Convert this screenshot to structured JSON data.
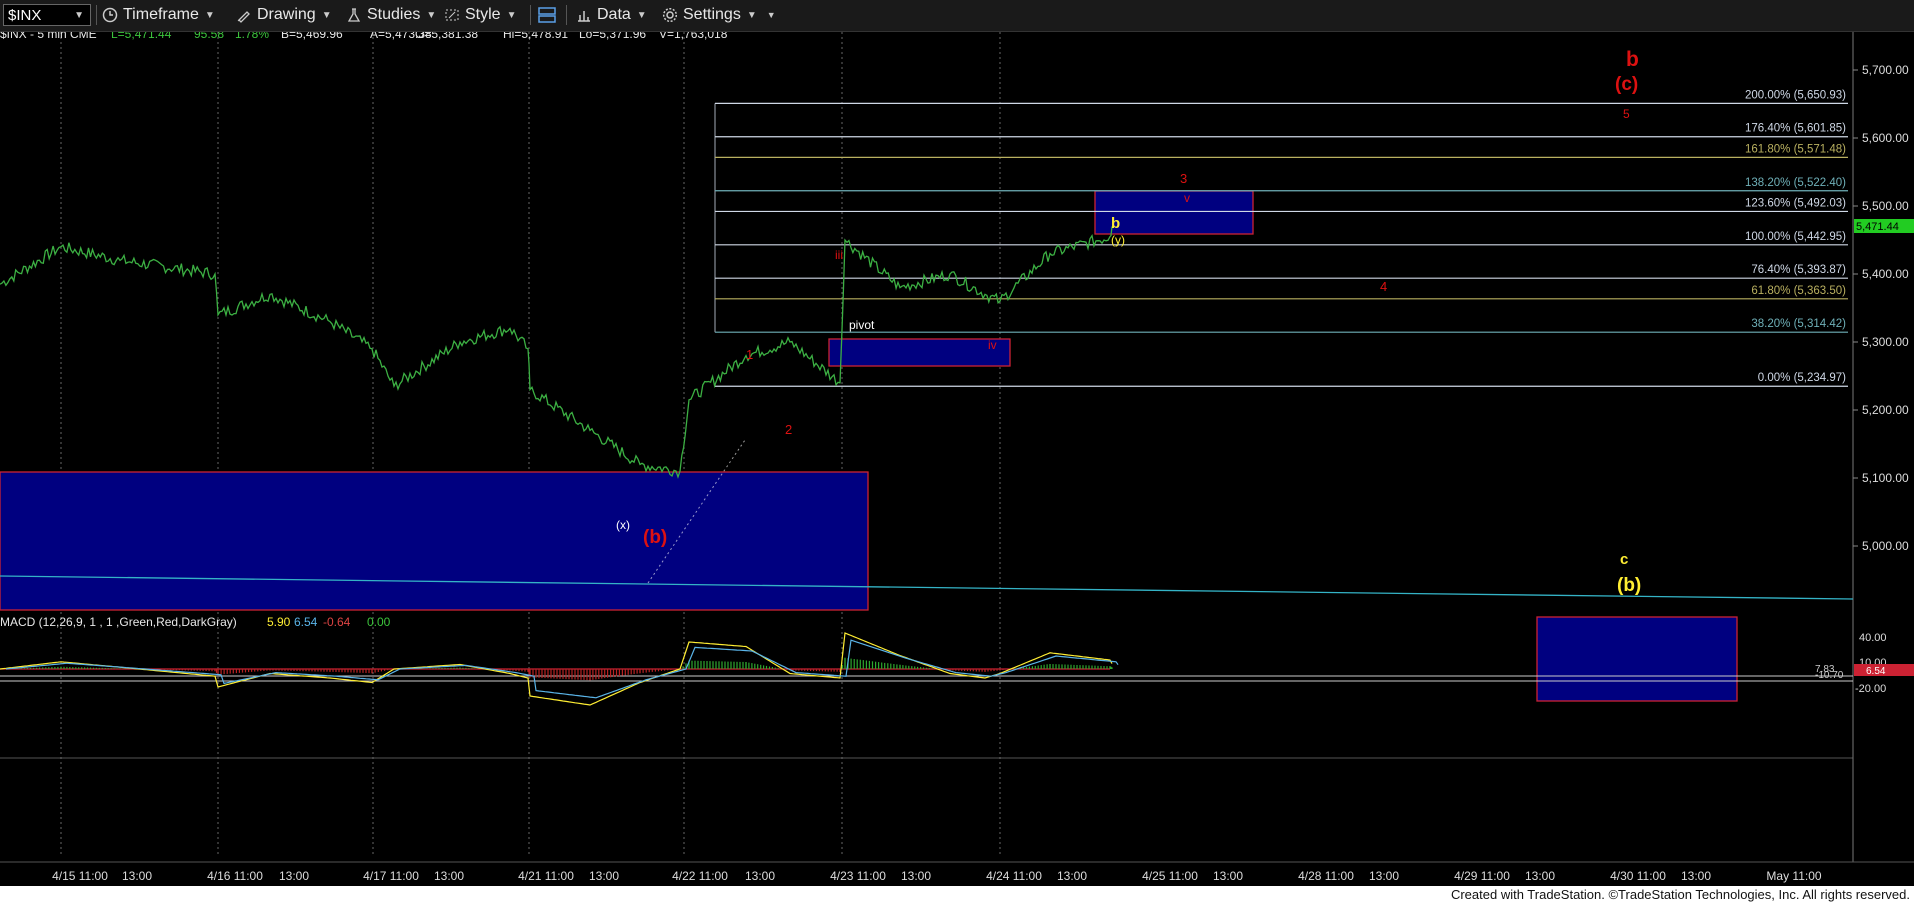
{
  "toolbar": {
    "symbol": "$INX",
    "timeframe": "Timeframe",
    "drawing": "Drawing",
    "studies": "Studies",
    "style": "Style",
    "data": "Data",
    "settings": "Settings"
  },
  "header": {
    "name": "$INX - 5 min CME",
    "last": "L=5,471.44",
    "change": "95.58",
    "pct": "1.78%",
    "bid": "B=5,469.96",
    "ask": "A=5,473.38",
    "open": "O=5,381.38",
    "high": "Hi=5,478.91",
    "low": "Lo=5,371.96",
    "volume": "V=1,763,018"
  },
  "macd": {
    "label": "MACD (12,26,9, 1 , 1 ,Green,Red,DarkGray)",
    "v1": "5.90",
    "v2": "6.54",
    "v3": "-0.64",
    "v4": "0.00",
    "axis": [
      "40.00",
      "10.00",
      "-20.00"
    ],
    "tag_a": "7.83",
    "tag_b": "-10.70",
    "tag_c": "6.54"
  },
  "price_axis": [
    "5,700.00",
    "5,600.00",
    "5,500.00",
    "5,400.00",
    "5,300.00",
    "5,200.00",
    "5,100.00",
    "5,000.00"
  ],
  "last_price_tag": "5,471.44",
  "time_axis": [
    "4/15 11:00",
    "13:00",
    "4/16 11:00",
    "13:00",
    "4/17 11:00",
    "13:00",
    "4/21 11:00",
    "13:00",
    "4/22 11:00",
    "13:00",
    "4/23 11:00",
    "13:00",
    "4/24 11:00",
    "13:00",
    "4/25 11:00",
    "13:00",
    "4/28 11:00",
    "13:00",
    "4/29 11:00",
    "13:00",
    "4/30 11:00",
    "13:00",
    "May 11:00"
  ],
  "fib_levels": [
    "200.00% (5,650.93)",
    "176.40% (5,601.85)",
    "161.80% (5,571.48)",
    "138.20% (5,522.40)",
    "123.60% (5,492.03)",
    "100.00% (5,442.95)",
    "76.40% (5,393.87)",
    "61.80% (5,363.50)",
    "38.20% (5,314.42)",
    "0.00% (5,234.97)"
  ],
  "annotations": {
    "red_b": "b",
    "red_c": "(c)",
    "red_5": "5",
    "red_3": "3",
    "red_v": "v",
    "red_4": "4",
    "red_iii": "iii",
    "red_iv": "iv",
    "red_1": "1",
    "red_2": "2",
    "red_b_paren": "(b)",
    "white_x": "(x)",
    "yellow_b": "b",
    "yellow_y": "(y)",
    "yellow_c": "c",
    "yellow_b_paren": "(b)",
    "pivot": "pivot"
  },
  "colors": {
    "price_line": "#3cb043",
    "fib_line": "#cfd8e6",
    "zone_fill": "#000080",
    "zone_border": "#cc2233",
    "red_label": "#dd1111",
    "yellow_label": "#ffee33",
    "last_tag": "#22cc22"
  },
  "chart_data": {
    "type": "line",
    "title": "$INX - 5 min CME",
    "xlabel": "",
    "ylabel": "",
    "ylim": [
      4900,
      5760
    ],
    "series": [
      {
        "name": "$INX",
        "x": [
          "4/15 09:30",
          "4/15 11:00",
          "4/15 13:00",
          "4/15 15:00",
          "4/16 09:30",
          "4/16 11:00",
          "4/16 13:00",
          "4/16 15:00",
          "4/17 09:30",
          "4/17 11:00",
          "4/17 13:00",
          "4/17 15:00",
          "4/21 09:30",
          "4/21 11:00",
          "4/21 13:00",
          "4/21 15:00",
          "4/22 09:30",
          "4/22 11:00",
          "4/22 13:00",
          "4/22 15:00",
          "4/23 09:30",
          "4/23 11:00",
          "4/23 13:00",
          "4/23 15:00",
          "4/24 09:30",
          "4/24 11:00",
          "4/24 13:00",
          "4/24 15:00"
        ],
        "values": [
          5385,
          5440,
          5420,
          5400,
          5340,
          5370,
          5330,
          5290,
          5235,
          5300,
          5320,
          5290,
          5230,
          5170,
          5120,
          5110,
          5215,
          5280,
          5300,
          5240,
          5450,
          5380,
          5400,
          5370,
          5360,
          5430,
          5455,
          5470
        ]
      },
      {
        "name": "MACD",
        "values": [
          0,
          8,
          2,
          -8,
          -20,
          -5,
          -10,
          -15,
          0,
          5,
          -5,
          -10,
          -30,
          -40,
          -15,
          0,
          30,
          25,
          -5,
          -10,
          40,
          15,
          -5,
          -10,
          -5,
          18,
          10,
          6
        ]
      }
    ]
  }
}
